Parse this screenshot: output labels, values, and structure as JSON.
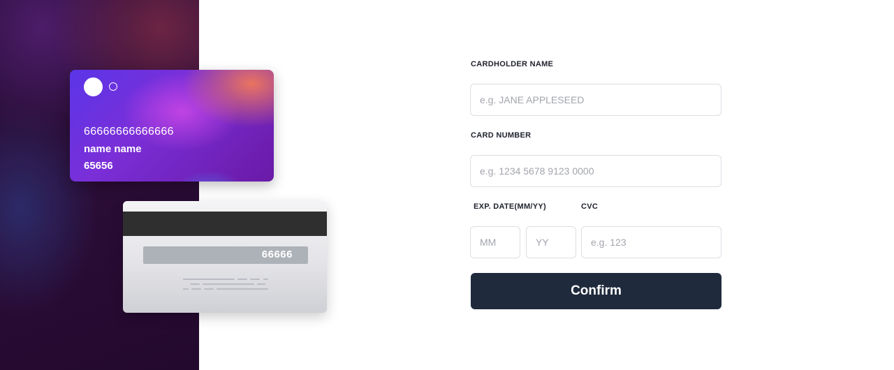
{
  "card_front": {
    "number": "66666666666666",
    "name": "name name",
    "expiry": "65656"
  },
  "card_back": {
    "cvc": "66666"
  },
  "form": {
    "cardholder": {
      "label": "CARDHOLDER NAME",
      "placeholder": "e.g. JANE APPLESEED",
      "value": ""
    },
    "card_number": {
      "label": "CARD NUMBER",
      "placeholder": "e.g. 1234 5678 9123 0000",
      "value": ""
    },
    "expiry": {
      "label": "EXP. DATE(MM/YY)",
      "month_placeholder": "MM",
      "year_placeholder": "YY"
    },
    "cvc": {
      "label": "CVC",
      "placeholder": "e.g. 123"
    },
    "confirm_label": "Confirm"
  },
  "colors": {
    "button_bg": "#1f2a3c",
    "label_text": "#21232e",
    "input_border": "#dedde4",
    "placeholder_text": "#a3a5ad"
  }
}
